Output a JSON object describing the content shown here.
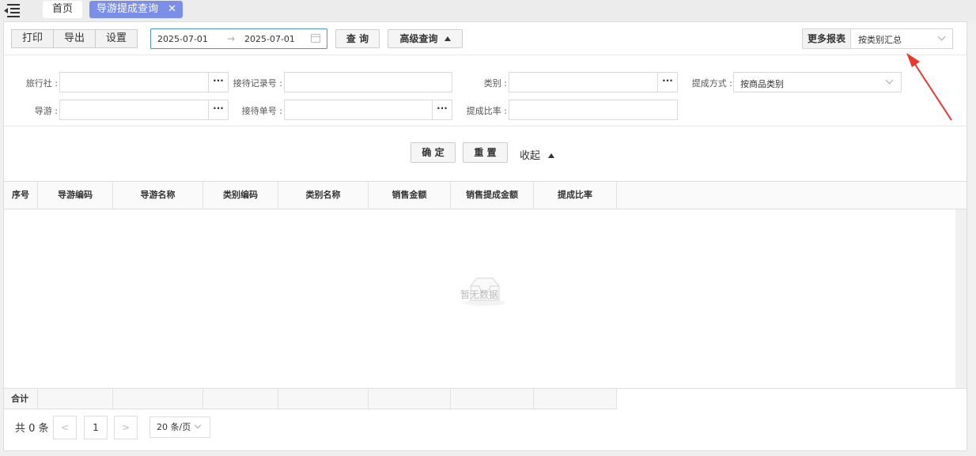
{
  "topbar": {
    "home_tab": "首页",
    "active_tab": "导游提成查询",
    "close_glyph": "✕"
  },
  "toolbar": {
    "print": "打印",
    "export": "导出",
    "settings": "设置",
    "date_from": "2025-07-01",
    "date_arrow": "→",
    "date_to": "2025-07-01",
    "query": "查 询",
    "advanced_query": "高级查询",
    "more_reports_label": "更多报表",
    "more_reports_value": "按类别汇总"
  },
  "filters": {
    "agency_label": "旅行社 :",
    "reception_record_label": "接待记录号 :",
    "category_label": "类别 :",
    "commission_method_label": "提成方式 :",
    "commission_method_value": "按商品类别",
    "guide_label": "导游 :",
    "reception_no_label": "接待单号 :",
    "commission_rate_label": "提成比率 :",
    "dots": "···"
  },
  "actions": {
    "confirm": "确 定",
    "reset": "重 置",
    "collapse": "收起"
  },
  "table": {
    "columns": [
      "序号",
      "导游编码",
      "导游名称",
      "类别编码",
      "类别名称",
      "销售金额",
      "销售提成金额",
      "提成比率"
    ],
    "empty_text": "暂无数据",
    "footer_label": "合计"
  },
  "pagination": {
    "total": "共 0 条",
    "prev": "<",
    "page": "1",
    "next": ">",
    "page_size": "20 条/页"
  },
  "colors": {
    "active_tab": "#7b8ee8",
    "date_border": "#4a90e2",
    "annotation_arrow": "#e8372c"
  }
}
